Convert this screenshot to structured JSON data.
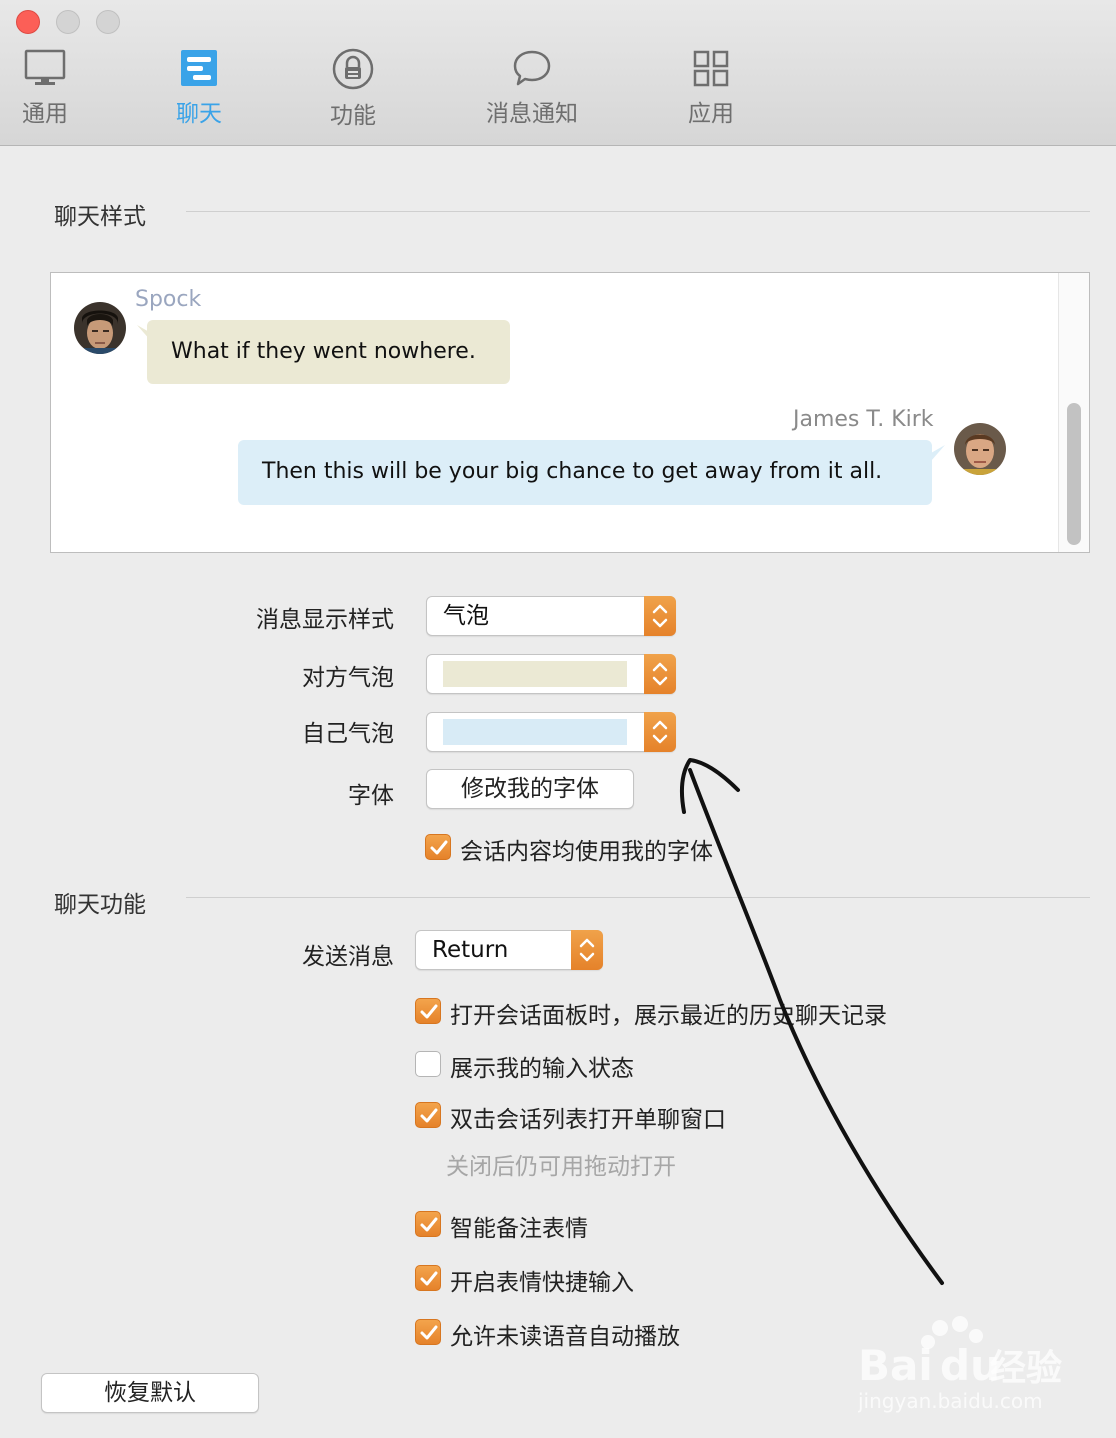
{
  "toolbar": {
    "tabs": [
      {
        "label": "通用",
        "icon": "monitor-icon"
      },
      {
        "label": "聊天",
        "icon": "chat-bubble-style-icon",
        "active": true
      },
      {
        "label": "功能",
        "icon": "lock-icon"
      },
      {
        "label": "消息通知",
        "icon": "speech-bubble-icon"
      },
      {
        "label": "应用",
        "icon": "grid-icon"
      }
    ]
  },
  "chat_style": {
    "title": "聊天样式",
    "preview": {
      "incoming": {
        "name": "Spock",
        "text": "What if they went nowhere."
      },
      "outgoing": {
        "name": "James T. Kirk",
        "text": "Then this will be your big chance to get away from it all."
      }
    },
    "message_style": {
      "label": "消息显示样式",
      "value": "气泡"
    },
    "their_bubble": {
      "label": "对方气泡",
      "color": "#ebe9d4"
    },
    "my_bubble": {
      "label": "自己气泡",
      "color": "#d8ebf6"
    },
    "font": {
      "label": "字体",
      "button": "修改我的字体"
    },
    "use_my_font": {
      "label": "会话内容均使用我的字体",
      "checked": true
    }
  },
  "chat_features": {
    "title": "聊天功能",
    "send": {
      "label": "发送消息",
      "value": "Return"
    },
    "options": [
      {
        "label": "打开会话面板时，展示最近的历史聊天记录",
        "checked": true
      },
      {
        "label": "展示我的输入状态",
        "checked": false
      },
      {
        "label": "双击会话列表打开单聊窗口",
        "checked": true
      },
      {
        "label": "智能备注表情",
        "checked": true
      },
      {
        "label": "开启表情快捷输入",
        "checked": true
      },
      {
        "label": "允许未读语音自动播放",
        "checked": true
      }
    ],
    "hint": "关闭后仍可用拖动打开"
  },
  "footer": {
    "restore_button": "恢复默认"
  },
  "watermark": {
    "logo": "Bai du 经验",
    "url": "jingyan.baidu.com"
  },
  "colors": {
    "accent": "#3aa3e8",
    "checkbox": "#e98a2e"
  }
}
